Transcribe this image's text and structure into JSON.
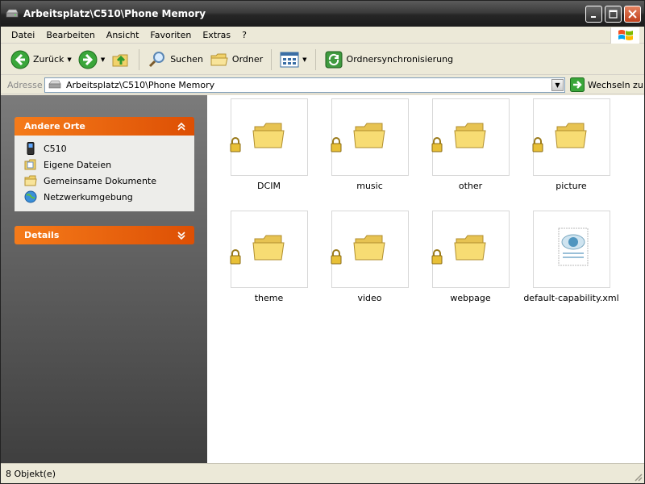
{
  "window": {
    "title": "Arbeitsplatz\\C510\\Phone Memory"
  },
  "menu": [
    "Datei",
    "Bearbeiten",
    "Ansicht",
    "Favoriten",
    "Extras",
    "?"
  ],
  "toolbar": {
    "back_label": "Zurück",
    "search_label": "Suchen",
    "folders_label": "Ordner",
    "sync_label": "Ordnersynchronisierung"
  },
  "address": {
    "label": "Adresse",
    "value": "Arbeitsplatz\\C510\\Phone Memory",
    "go_label": "Wechseln zu"
  },
  "sidebar": {
    "other_places": {
      "title": "Andere Orte",
      "items": [
        "C510",
        "Eigene Dateien",
        "Gemeinsame Dokumente",
        "Netzwerkumgebung"
      ]
    },
    "details": {
      "title": "Details"
    }
  },
  "files": [
    {
      "name": "DCIM",
      "type": "folder"
    },
    {
      "name": "music",
      "type": "folder"
    },
    {
      "name": "other",
      "type": "folder"
    },
    {
      "name": "picture",
      "type": "folder"
    },
    {
      "name": "theme",
      "type": "folder"
    },
    {
      "name": "video",
      "type": "folder"
    },
    {
      "name": "webpage",
      "type": "folder"
    },
    {
      "name": "default-capability.xml",
      "type": "xml-file"
    }
  ],
  "status": {
    "text": "8 Objekt(e)"
  },
  "colors": {
    "panel_header": "#e8640e",
    "title_bar": "#2a2a2a",
    "folder": "#f6d96a"
  }
}
